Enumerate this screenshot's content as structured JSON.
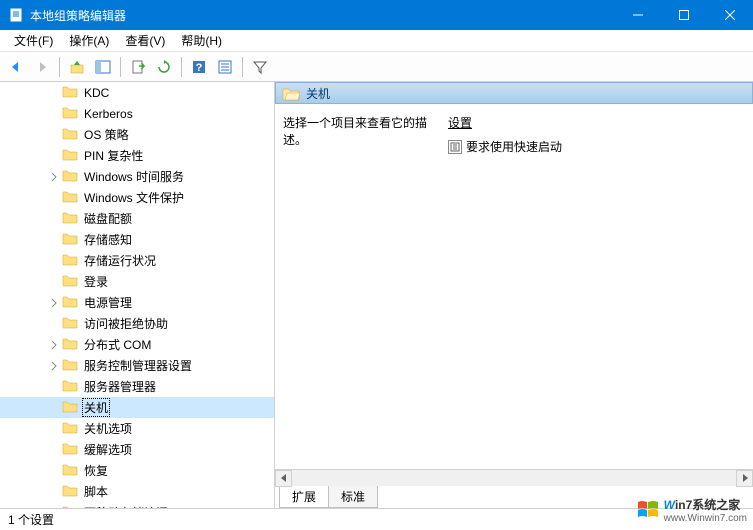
{
  "window": {
    "title": "本地组策略编辑器"
  },
  "menu": {
    "file": "文件(F)",
    "action": "操作(A)",
    "view": "查看(V)",
    "help": "帮助(H)"
  },
  "tree": {
    "items": [
      {
        "label": "KDC",
        "expandable": false
      },
      {
        "label": "Kerberos",
        "expandable": false
      },
      {
        "label": "OS 策略",
        "expandable": false
      },
      {
        "label": "PIN 复杂性",
        "expandable": false
      },
      {
        "label": "Windows 时间服务",
        "expandable": true
      },
      {
        "label": "Windows 文件保护",
        "expandable": false
      },
      {
        "label": "磁盘配额",
        "expandable": false
      },
      {
        "label": "存储感知",
        "expandable": false
      },
      {
        "label": "存储运行状况",
        "expandable": false
      },
      {
        "label": "登录",
        "expandable": false
      },
      {
        "label": "电源管理",
        "expandable": true
      },
      {
        "label": "访问被拒绝协助",
        "expandable": false
      },
      {
        "label": "分布式 COM",
        "expandable": true
      },
      {
        "label": "服务控制管理器设置",
        "expandable": true
      },
      {
        "label": "服务器管理器",
        "expandable": false
      },
      {
        "label": "关机",
        "expandable": false,
        "selected": true
      },
      {
        "label": "关机选项",
        "expandable": false
      },
      {
        "label": "缓解选项",
        "expandable": false
      },
      {
        "label": "恢复",
        "expandable": false
      },
      {
        "label": "脚本",
        "expandable": false
      },
      {
        "label": "可移动存储访问",
        "expandable": false
      }
    ]
  },
  "details": {
    "header": "关机",
    "description": "选择一个项目来查看它的描述。",
    "settings_header": "设置",
    "settings": [
      {
        "label": "要求使用快速启动"
      }
    ]
  },
  "tabs": {
    "extended": "扩展",
    "standard": "标准"
  },
  "status": {
    "text": "1 个设置"
  },
  "watermark": {
    "brand_w": "W",
    "brand_rest": "in7系统之家",
    "url": "www.Winwin7.com"
  }
}
